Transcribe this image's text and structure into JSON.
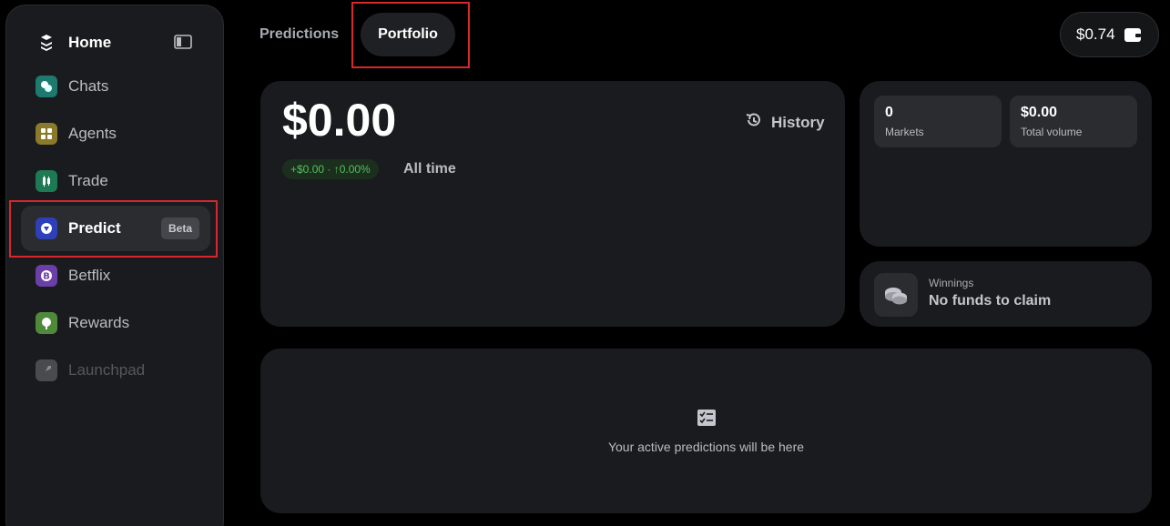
{
  "sidebar": {
    "home_label": "Home",
    "items": [
      {
        "label": "Chats",
        "icon": "chat-icon",
        "color": "#1e7a6e"
      },
      {
        "label": "Agents",
        "icon": "agents-grid-icon",
        "color": "#8a7a2a"
      },
      {
        "label": "Trade",
        "icon": "candlestick-icon",
        "color": "#1e7a55"
      },
      {
        "label": "Predict",
        "icon": "predict-shield-icon",
        "color": "#2e3fb8",
        "badge": "Beta",
        "active": true
      },
      {
        "label": "Betflix",
        "icon": "betflix-coin-icon",
        "color": "#6a3fa8"
      },
      {
        "label": "Rewards",
        "icon": "rewards-tree-icon",
        "color": "#4e8a3a"
      },
      {
        "label": "Launchpad",
        "icon": "rocket-icon",
        "color": "#4a4b50",
        "disabled": true
      }
    ]
  },
  "tabs": {
    "predictions": "Predictions",
    "portfolio": "Portfolio"
  },
  "wallet": {
    "balance": "$0.74"
  },
  "portfolio": {
    "balance": "$0.00",
    "history_label": "History",
    "change": "+$0.00 · ↑0.00%",
    "range": "All time"
  },
  "stats": {
    "markets_value": "0",
    "markets_label": "Markets",
    "volume_value": "$0.00",
    "volume_label": "Total volume"
  },
  "winnings": {
    "label": "Winnings",
    "value": "No funds to claim"
  },
  "active": {
    "empty_text": "Your active predictions will be here"
  },
  "colors": {
    "accent_green": "#4fc35a",
    "highlight_red": "#d9262b"
  }
}
